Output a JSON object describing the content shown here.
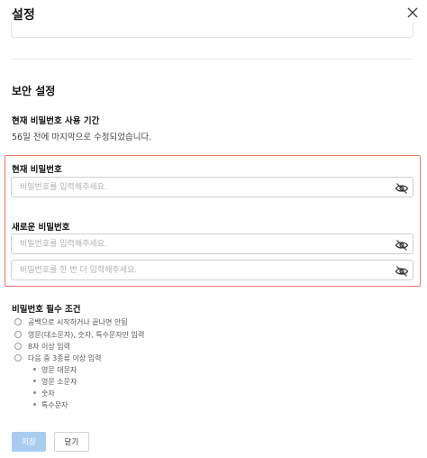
{
  "header": {
    "title": "설정",
    "close_icon": "close-icon"
  },
  "security": {
    "section_title": "보안 설정",
    "usage_label": "현재 비밀번호 사용 기간",
    "usage_text": "56일 전에 마지막으로 수정되었습니다."
  },
  "current_password": {
    "label": "현재 비밀번호",
    "placeholder": "비밀번호를 입력해주세요.",
    "value": ""
  },
  "new_password": {
    "label": "새로운 비밀번호",
    "placeholder": "비밀번호를 입력해주세요.",
    "confirm_placeholder": "비밀번호를 한 번 더 입력해주세요.",
    "value": "",
    "confirm_value": ""
  },
  "requirements": {
    "title": "비밀번호 필수 조건",
    "items": [
      "공백으로 시작하거나 끝나면 안됨",
      "영문(대소문자), 숫자, 특수문자만 입력",
      "8자 이상 입력",
      "다음 중 3종류 이상 입력"
    ],
    "sub_items": [
      "영문 대문자",
      "영문 소문자",
      "숫자",
      "특수문자"
    ]
  },
  "buttons": {
    "save": "저장",
    "close": "닫기"
  },
  "colors": {
    "highlight_border": "#e8796a",
    "save_button": "#a9cdf0"
  }
}
